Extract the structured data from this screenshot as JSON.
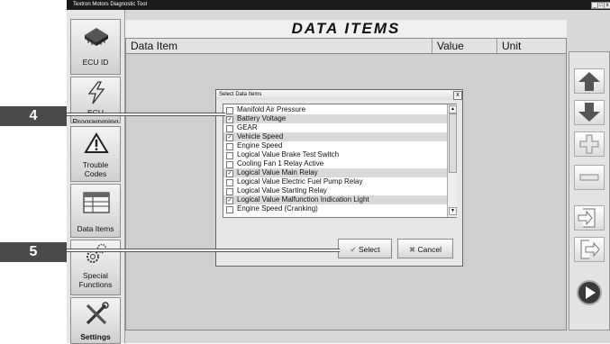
{
  "window": {
    "title": "Textron Motors Diagnostic Tool",
    "controls": [
      "_",
      "□",
      "x"
    ]
  },
  "sidebar": {
    "items": [
      {
        "label": "ECU ID",
        "icon": "chip-icon"
      },
      {
        "label": "ECU Programming",
        "icon": "lightning-icon"
      },
      {
        "label": "Trouble Codes",
        "icon": "warning-icon"
      },
      {
        "label": "Data Items",
        "icon": "table-icon"
      },
      {
        "label": "Special Functions",
        "icon": "gears-icon"
      },
      {
        "label": "Settings",
        "icon": "tools-icon"
      }
    ]
  },
  "header": {
    "title": "DATA ITEMS"
  },
  "table": {
    "columns": [
      "Data Item",
      "Value",
      "Unit"
    ]
  },
  "right_panel": {
    "buttons": [
      "arrow-up-icon",
      "arrow-down-icon",
      "plus-icon",
      "minus-icon",
      "import-icon",
      "export-icon",
      "play-icon"
    ]
  },
  "dialog": {
    "title": "Select Data Items",
    "close": "x",
    "items": [
      {
        "label": "Manifold Air Pressure",
        "checked": false
      },
      {
        "label": "Battery Voltage",
        "checked": true
      },
      {
        "label": "GEAR",
        "checked": false
      },
      {
        "label": "Vehicle Speed",
        "checked": true
      },
      {
        "label": "Engine Speed",
        "checked": false
      },
      {
        "label": "Logical Value Brake Test Switch",
        "checked": false
      },
      {
        "label": "Cooling Fan 1 Relay Active",
        "checked": false
      },
      {
        "label": "Logical Value Main Relay",
        "checked": true
      },
      {
        "label": "Logical Value Electric Fuel Pump Relay",
        "checked": false
      },
      {
        "label": "Logical Value Starting Relay",
        "checked": false
      },
      {
        "label": "Logical Value Malfunction Indication Light",
        "checked": true
      },
      {
        "label": "Engine Speed (Cranking)",
        "checked": false
      }
    ],
    "select_label": "Select",
    "cancel_label": "Cancel"
  },
  "callouts": [
    "4",
    "5"
  ]
}
